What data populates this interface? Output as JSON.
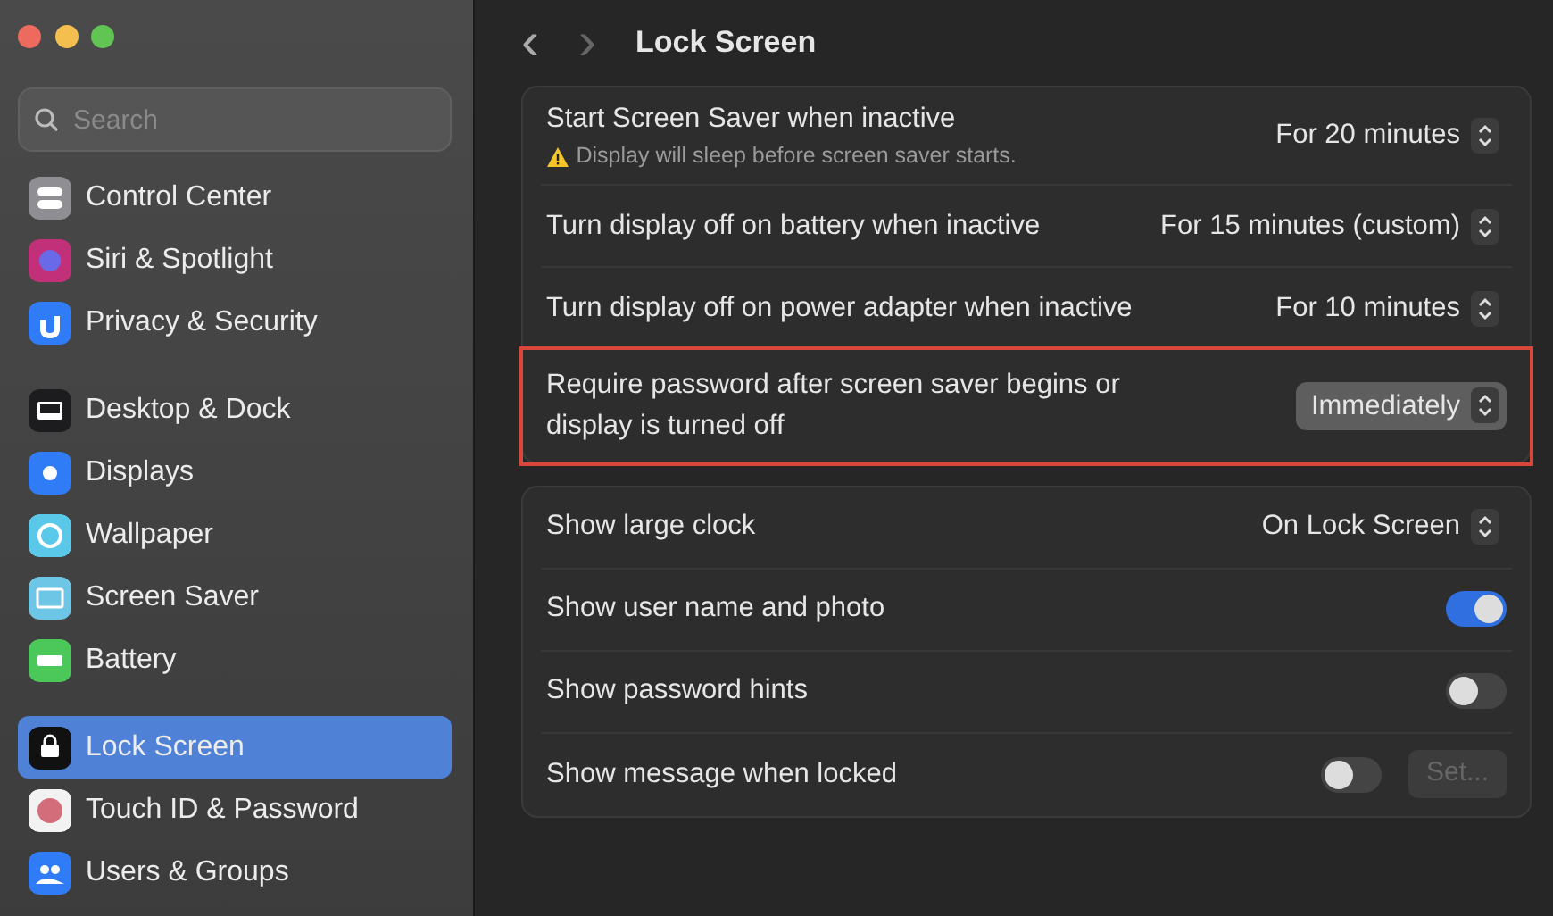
{
  "window": {
    "title": "Lock Screen",
    "back": "‹",
    "forward": "›"
  },
  "sidebar": {
    "search": {
      "placeholder": "Search"
    },
    "groups": [
      [
        {
          "label": "Control Center",
          "color": "#8e8e93",
          "selected": false
        },
        {
          "label": "Siri & Spotlight",
          "color": "#c2307a",
          "selected": false
        },
        {
          "label": "Privacy & Security",
          "color": "#2f7cf6",
          "selected": false
        }
      ],
      [
        {
          "label": "Desktop & Dock",
          "color": "#1c1c1e",
          "selected": false
        },
        {
          "label": "Displays",
          "color": "#2f7cf6",
          "selected": false
        },
        {
          "label": "Wallpaper",
          "color": "#5ac8e8",
          "selected": false
        },
        {
          "label": "Screen Saver",
          "color": "#6ec6e6",
          "selected": false
        },
        {
          "label": "Battery",
          "color": "#4cc75a",
          "selected": false
        }
      ],
      [
        {
          "label": "Lock Screen",
          "color": "#111111",
          "selected": true
        },
        {
          "label": "Touch ID & Password",
          "color": "#f2f2f2",
          "selected": false
        },
        {
          "label": "Users & Groups",
          "color": "#2f7cf6",
          "selected": false
        }
      ]
    ]
  },
  "sections": [
    [
      {
        "kind": "select",
        "label": "Start Screen Saver when inactive",
        "note": "Display will sleep before screen saver starts.",
        "value": "For 20 minutes",
        "highlighted": false
      },
      {
        "kind": "select",
        "label": "Turn display off on battery when inactive",
        "value": "For 15 minutes (custom)",
        "highlighted": false
      },
      {
        "kind": "select",
        "label": "Turn display off on power adapter when inactive",
        "value": "For 10 minutes",
        "highlighted": false
      },
      {
        "kind": "select",
        "label": "Require password after screen saver begins or display is turned off",
        "value": "Immediately",
        "highlighted": true
      }
    ],
    [
      {
        "kind": "select",
        "label": "Show large clock",
        "value": "On Lock Screen",
        "highlighted": false
      },
      {
        "kind": "toggle",
        "label": "Show user name and photo",
        "on": true
      },
      {
        "kind": "toggle",
        "label": "Show password hints",
        "on": false
      },
      {
        "kind": "toggle",
        "label": "Show message when locked",
        "on": false,
        "button": {
          "label": "Set...",
          "disabled": true
        }
      }
    ]
  ]
}
